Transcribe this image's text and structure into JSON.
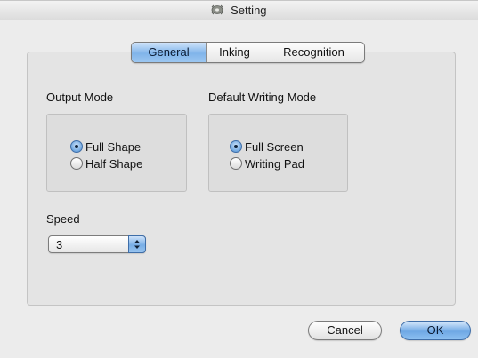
{
  "window": {
    "title": "Setting",
    "title_icon": "gear-icon"
  },
  "tabs": [
    {
      "label": "General",
      "selected": true
    },
    {
      "label": "Inking",
      "selected": false
    },
    {
      "label": "Recognition",
      "selected": false
    }
  ],
  "general": {
    "output_mode": {
      "label": "Output Mode",
      "options": [
        {
          "label": "Full Shape",
          "selected": true
        },
        {
          "label": "Half Shape",
          "selected": false
        }
      ]
    },
    "writing_mode": {
      "label": "Default Writing Mode",
      "options": [
        {
          "label": "Full Screen",
          "selected": true
        },
        {
          "label": "Writing Pad",
          "selected": false
        }
      ]
    },
    "speed": {
      "label": "Speed",
      "value": "3"
    }
  },
  "buttons": {
    "cancel": "Cancel",
    "ok": "OK"
  },
  "colors": {
    "accent": "#80b4ea",
    "accent_border": "#3f6ea8"
  }
}
